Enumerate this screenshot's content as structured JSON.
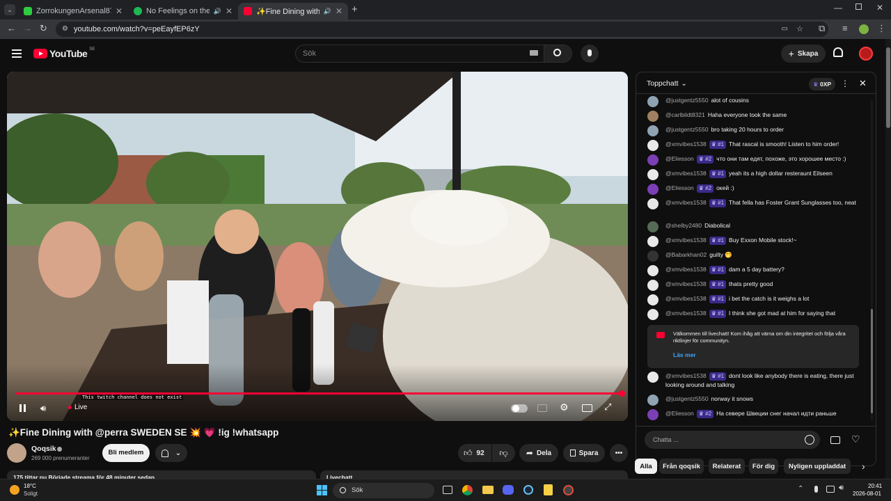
{
  "browser": {
    "tabs": [
      {
        "title": "ZorrokungenArsenal8788 Strea",
        "color": "#2ecc40"
      },
      {
        "title": "No Feelings on the Floor -",
        "color": "#1db954"
      },
      {
        "title": "✨Fine Dining with @p",
        "color": "#ff0033"
      }
    ],
    "url": "youtube.com/watch?v=peEayfEP6zY"
  },
  "yt": {
    "logo": "YouTube",
    "region": "SE",
    "search_placeholder": "Sök",
    "create_label": "Skapa"
  },
  "video": {
    "live_label": "Live",
    "caption": "This twitch channel does not exist",
    "progress_pct": 100
  },
  "meta": {
    "title": "✨Fine Dining with @perra SWEDEN SE 💥 💗 !ig !whatsapp",
    "channel": "Qoqsik",
    "subscribers": "269 000 prenumeranter",
    "join_label": "Bli medlem",
    "likes": "92",
    "share_label": "Dela",
    "save_label": "Spara",
    "desc_left": "175 tittar nu  Började streama för 48 minuter sedan",
    "desc_right": "Livechatt"
  },
  "chat": {
    "header": "Toppchatt",
    "xp": "0XP",
    "messages": [
      {
        "user": "@justgentz5550",
        "badge": "",
        "text": "alot of cousins",
        "color": "#8fa3b3"
      },
      {
        "user": "@carlbildt8321",
        "badge": "",
        "text": "Haha everyone took the same",
        "color": "#a08060"
      },
      {
        "user": "@justgentz5550",
        "badge": "",
        "text": "bro taking 20 hours to order",
        "color": "#8fa3b3"
      },
      {
        "user": "@xmvibes1538",
        "badge": "#1",
        "text": "That rascal is smooth! Listen to him order!",
        "color": "#e8e8e8"
      },
      {
        "user": "@Eliesson",
        "badge": "#2",
        "text": "что они там едят, похоже, это хорошее место :)",
        "color": "#7b3fb5"
      },
      {
        "user": "@xmvibes1538",
        "badge": "#1",
        "text": "yeah its a high dollar resteraunt Eilseen",
        "color": "#e8e8e8"
      },
      {
        "user": "@Eliesson",
        "badge": "#2",
        "text": "окей :)",
        "color": "#7b3fb5"
      },
      {
        "user": "@xmvibes1538",
        "badge": "#1",
        "text": "That fella has Foster Grant Sunglasses too, neat",
        "color": "#e8e8e8"
      },
      {
        "user": "@shelby2480",
        "badge": "",
        "text": "Diabolical",
        "color": "#556b55"
      },
      {
        "user": "@xmvibes1538",
        "badge": "#1",
        "text": "Buy Exxon Mobile stock!~",
        "color": "#e8e8e8"
      },
      {
        "user": "@Babarkhan02",
        "badge": "",
        "text": "guilty 🤭",
        "color": "#333333"
      },
      {
        "user": "@xmvibes1538",
        "badge": "#1",
        "text": "dam a 5 day battery?",
        "color": "#e8e8e8"
      },
      {
        "user": "@xmvibes1538",
        "badge": "#1",
        "text": "thats pretty good",
        "color": "#e8e8e8"
      },
      {
        "user": "@xmvibes1538",
        "badge": "#1",
        "text": "i bet the catch is it weighs a lot",
        "color": "#e8e8e8"
      },
      {
        "user": "@xmvibes1538",
        "badge": "#1",
        "text": "I think she got mad at him for saying that",
        "color": "#e8e8e8"
      }
    ],
    "notice": "Välkommen till livechatt! Kom ihåg att värna om din integritet och följa våra riktlinjer för communityn.",
    "notice_link": "Läs mer",
    "after": [
      {
        "user": "@xmvibes1538",
        "badge": "#1",
        "text": "dont look like anybody there is eating, there just looking around and talking",
        "color": "#e8e8e8"
      },
      {
        "user": "@justgentz5550",
        "badge": "",
        "text": "norway it snows",
        "color": "#8fa3b3"
      },
      {
        "user": "@Eliesson",
        "badge": "#2",
        "text": "На севере Швеции снег начал идти раньше",
        "color": "#7b3fb5"
      }
    ],
    "input_placeholder": "Chatta ..."
  },
  "chips": [
    "Alla",
    "Från qoqsik",
    "Relaterat",
    "För dig",
    "Nyligen uppladdat"
  ],
  "taskbar": {
    "temp": "18°C",
    "weather": "Soligt",
    "search": "Sök",
    "time": "20:41",
    "date": "2026-08-01"
  }
}
